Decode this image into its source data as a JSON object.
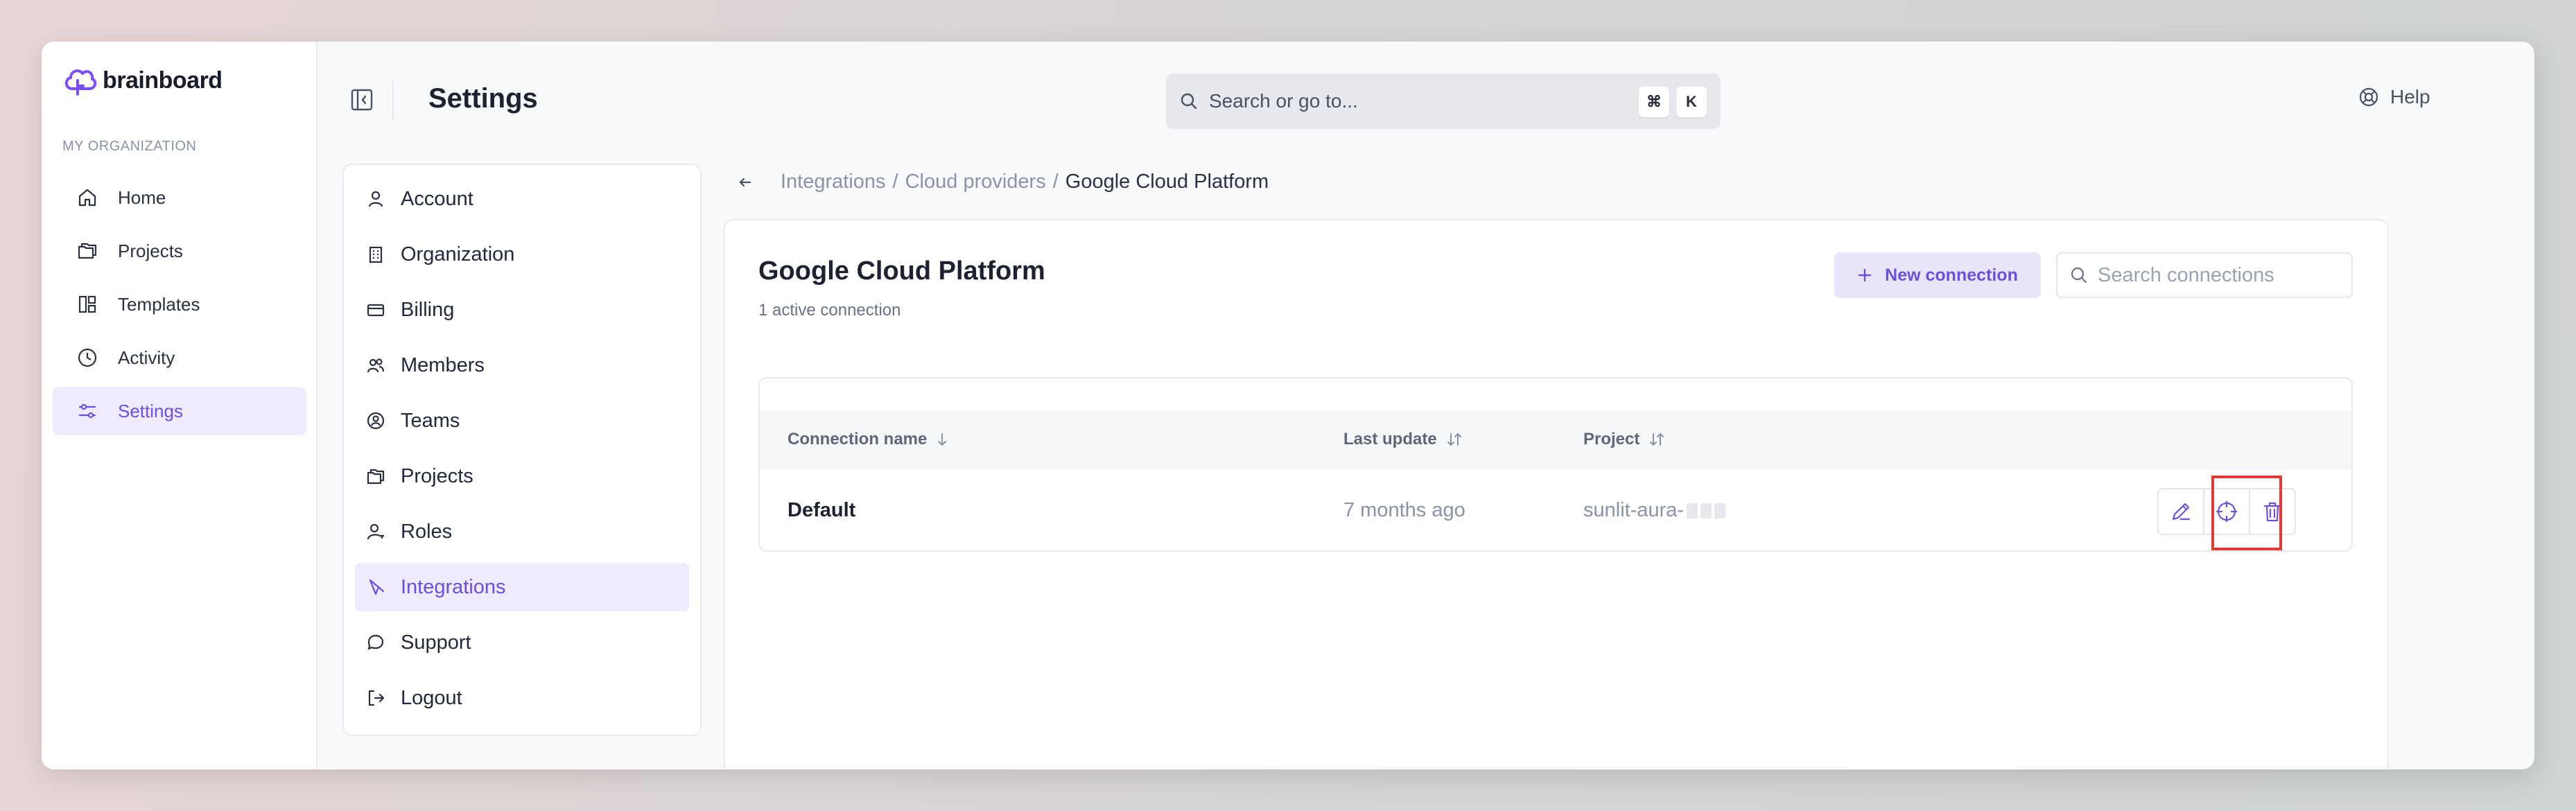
{
  "brand": {
    "name": "brainboard",
    "accent": "#6d4ee0"
  },
  "org_label": "MY ORGANIZATION",
  "nav": [
    {
      "label": "Home",
      "icon": "home-icon"
    },
    {
      "label": "Projects",
      "icon": "projects-icon"
    },
    {
      "label": "Templates",
      "icon": "templates-icon"
    },
    {
      "label": "Activity",
      "icon": "clock-icon"
    },
    {
      "label": "Settings",
      "icon": "sliders-icon",
      "active": true
    }
  ],
  "header": {
    "title": "Settings",
    "search_placeholder": "Search or go to...",
    "shortcut_keys": [
      "⌘",
      "K"
    ],
    "help_label": "Help"
  },
  "settings_menu": [
    {
      "label": "Account",
      "icon": "user-icon"
    },
    {
      "label": "Organization",
      "icon": "building-icon"
    },
    {
      "label": "Billing",
      "icon": "credit-card-icon"
    },
    {
      "label": "Members",
      "icon": "users-icon"
    },
    {
      "label": "Teams",
      "icon": "teams-icon"
    },
    {
      "label": "Projects",
      "icon": "projects-icon"
    },
    {
      "label": "Roles",
      "icon": "user-key-icon"
    },
    {
      "label": "Integrations",
      "icon": "integrations-icon",
      "active": true
    },
    {
      "label": "Support",
      "icon": "chat-icon"
    },
    {
      "label": "Logout",
      "icon": "logout-icon"
    }
  ],
  "breadcrumb": {
    "items": [
      "Integrations",
      "Cloud providers"
    ],
    "current": "Google Cloud Platform"
  },
  "main": {
    "title": "Google Cloud Platform",
    "subtitle": "1 active connection",
    "new_connection_label": "New connection",
    "search_placeholder": "Search connections"
  },
  "table": {
    "columns": [
      "Connection name",
      "Last update",
      "Project"
    ],
    "rows": [
      {
        "name": "Default",
        "last_update": "7 months ago",
        "project": "sunlit-aura-"
      }
    ]
  }
}
